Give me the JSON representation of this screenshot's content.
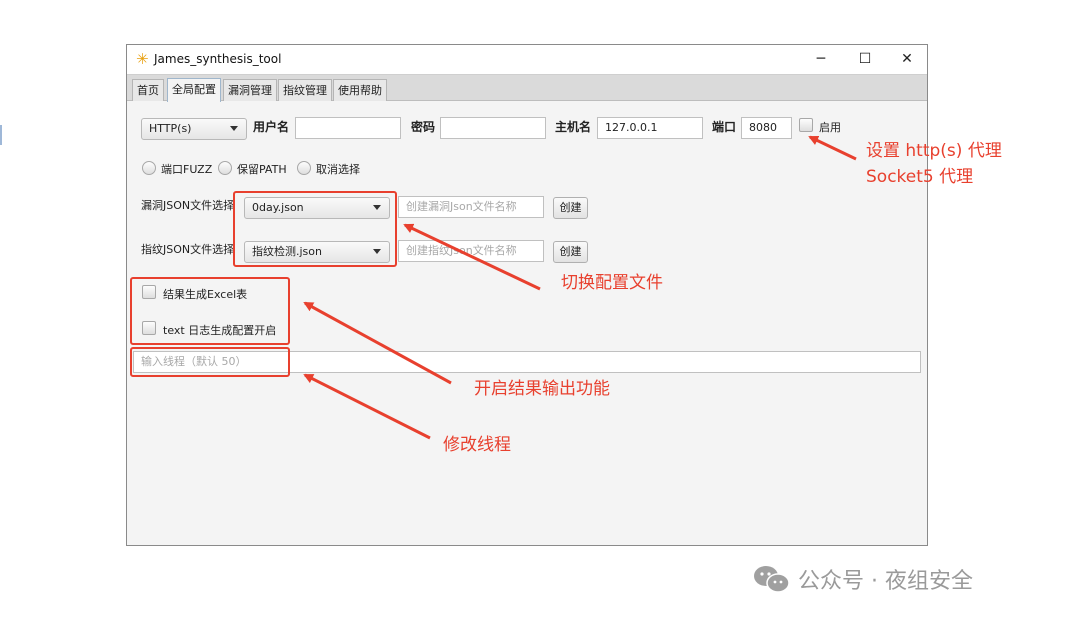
{
  "window": {
    "title": "James_synthesis_tool",
    "controls": {
      "minimize": "─",
      "maximize": "☐",
      "close": "✕"
    }
  },
  "tabs": [
    {
      "label": "首页",
      "active": false
    },
    {
      "label": "全局配置",
      "active": true
    },
    {
      "label": "漏洞管理",
      "active": false
    },
    {
      "label": "指纹管理",
      "active": false
    },
    {
      "label": "使用帮助",
      "active": false
    }
  ],
  "proxy": {
    "type_selected": "HTTP(s)",
    "username_label": "用户名",
    "username_value": "",
    "password_label": "密码",
    "password_value": "",
    "host_label": "主机名",
    "host_value": "127.0.0.1",
    "port_label": "端口",
    "port_value": "8080",
    "enable_label": "启用"
  },
  "radios": [
    {
      "label": "端口FUZZ"
    },
    {
      "label": "保留PATH"
    },
    {
      "label": "取消选择"
    }
  ],
  "vuln_json": {
    "label": "漏洞JSON文件选择",
    "selected": "0day.json",
    "name_placeholder": "创建漏洞Json文件名称",
    "create_label": "创建"
  },
  "finger_json": {
    "label": "指纹JSON文件选择",
    "selected": "指纹检测.json",
    "name_placeholder": "创建指纹Json文件名称",
    "create_label": "创建"
  },
  "options": [
    {
      "label": "结果生成Excel表"
    },
    {
      "label": "text 日志生成配置开启"
    }
  ],
  "threads": {
    "placeholder": "输入线程（默认 50）"
  },
  "annotations": {
    "proxy_line1": "设置 http(s) 代理",
    "proxy_line2": "Socket5 代理",
    "switch_config": "切换配置文件",
    "output": "开启结果输出功能",
    "threads": "修改线程"
  },
  "watermark": "公众号 · 夜组安全",
  "colors": {
    "annotation": "#e8402e",
    "window_bg": "#f4f4f4",
    "tabbar": "#dadada"
  },
  "icons": {
    "app": "star-icon",
    "watermark": "wechat-icon"
  }
}
